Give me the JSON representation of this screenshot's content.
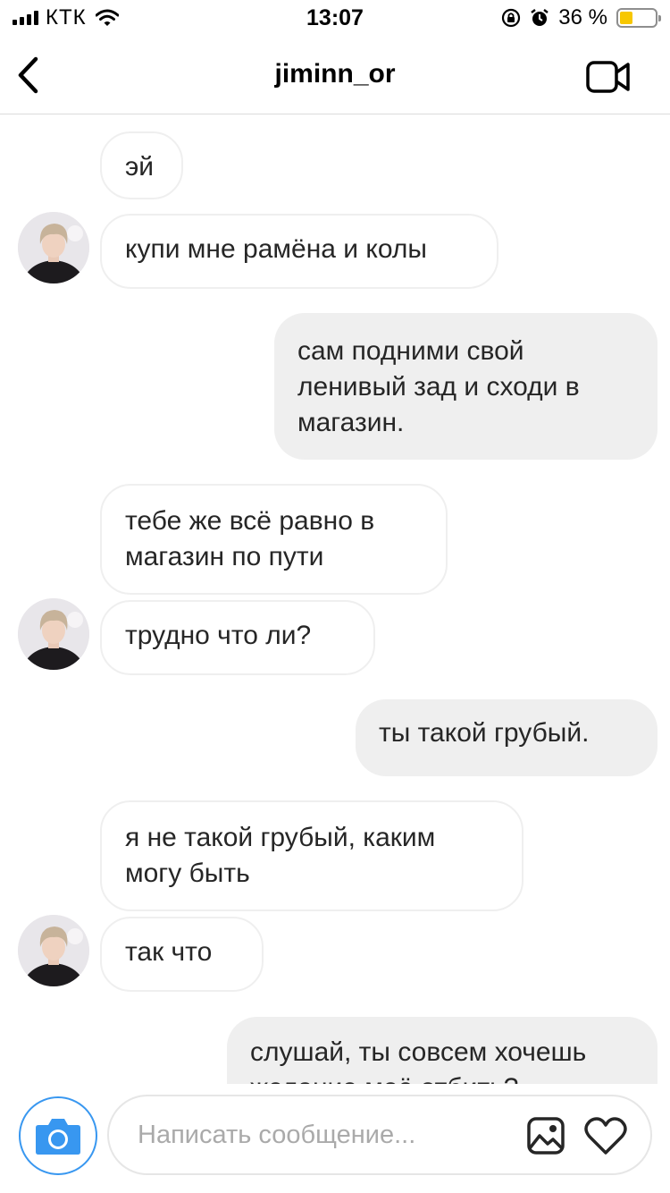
{
  "status_bar": {
    "carrier": "КТК",
    "time": "13:07",
    "battery_percent": "36 %",
    "battery_level": 0.36,
    "battery_color": "#f7c700"
  },
  "header": {
    "username": "jiminn_or",
    "back_icon": "chevron-left-icon",
    "video_icon": "video-camera-icon"
  },
  "messages": [
    {
      "direction": "in",
      "text": "эй"
    },
    {
      "direction": "in",
      "text": "купи мне рамёна и колы"
    },
    {
      "direction": "out",
      "text": "сам подними свой ленивый зад и сходи в магазин."
    },
    {
      "direction": "in",
      "text": "тебе же всё равно в магазин по пути"
    },
    {
      "direction": "in",
      "text": "трудно что ли?"
    },
    {
      "direction": "out",
      "text": "ты такой грубый."
    },
    {
      "direction": "in",
      "text": "я не такой грубый, каким могу быть"
    },
    {
      "direction": "in",
      "text": "так что"
    },
    {
      "direction": "out",
      "text": "слушай, ты совсем хочешь желание моё отбить?"
    }
  ],
  "composer": {
    "placeholder": "Написать сообщение...",
    "camera_icon": "camera-icon",
    "gallery_icon": "gallery-icon",
    "heart_icon": "heart-icon",
    "accent_color": "#3897f0"
  }
}
